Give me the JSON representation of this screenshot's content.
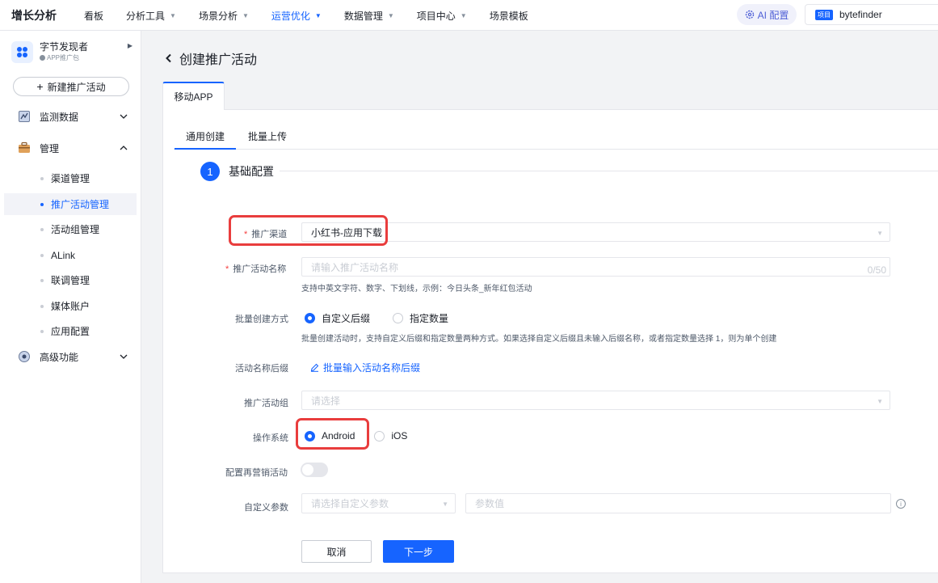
{
  "topbar": {
    "brand": "增长分析",
    "nav": [
      {
        "label": "看板",
        "caret": false,
        "active": false
      },
      {
        "label": "分析工具",
        "caret": true,
        "active": false
      },
      {
        "label": "场景分析",
        "caret": true,
        "active": false
      },
      {
        "label": "运营优化",
        "caret": true,
        "active": true
      },
      {
        "label": "数据管理",
        "caret": true,
        "active": false
      },
      {
        "label": "项目中心",
        "caret": true,
        "active": false
      },
      {
        "label": "场景模板",
        "caret": false,
        "active": false
      }
    ],
    "ai_label": "AI 配置",
    "project_badge": "项目",
    "project_name": "bytefinder"
  },
  "sidebar": {
    "app_name": "字节发现者",
    "app_sub": "APP推广包",
    "new_button": "新建推广活动",
    "groups": {
      "monitor": "监测数据",
      "manage": "管理",
      "advanced": "高级功能"
    },
    "items": [
      "渠道管理",
      "推广活动管理",
      "活动组管理",
      "ALink",
      "联调管理",
      "媒体账户",
      "应用配置"
    ]
  },
  "main": {
    "title": "创建推广活动",
    "card_tab": "移动APP",
    "subtabs": [
      "通用创建",
      "批量上传"
    ],
    "step_number": "1",
    "section_title": "基础配置",
    "form": {
      "channel_label": "推广渠道",
      "channel_value": "小红书-应用下载",
      "name_label": "推广活动名称",
      "name_placeholder": "请输入推广活动名称",
      "name_counter": "0/50",
      "name_hint": "支持中英文字符、数字、下划线，示例：今日头条_新年红包活动",
      "batch_label": "批量创建方式",
      "batch_options": [
        "自定义后缀",
        "指定数量"
      ],
      "batch_hint": "批量创建活动时，支持自定义后缀和指定数量两种方式。如果选择自定义后缀且未输入后缀名称，或者指定数量选择 1，则为单个创建",
      "suffix_label": "活动名称后缀",
      "suffix_link": "批量输入活动名称后缀",
      "group_label": "推广活动组",
      "group_placeholder": "请选择",
      "os_label": "操作系统",
      "os_options": [
        "Android",
        "iOS"
      ],
      "remarketing_label": "配置再营销活动",
      "param_label": "自定义参数",
      "param_select_placeholder": "请选择自定义参数",
      "param_value_placeholder": "参数值"
    },
    "buttons": {
      "cancel": "取消",
      "next": "下一步"
    }
  },
  "colors": {
    "accent": "#1664ff",
    "highlight": "#e93d3d",
    "required": "#f53f3f"
  }
}
